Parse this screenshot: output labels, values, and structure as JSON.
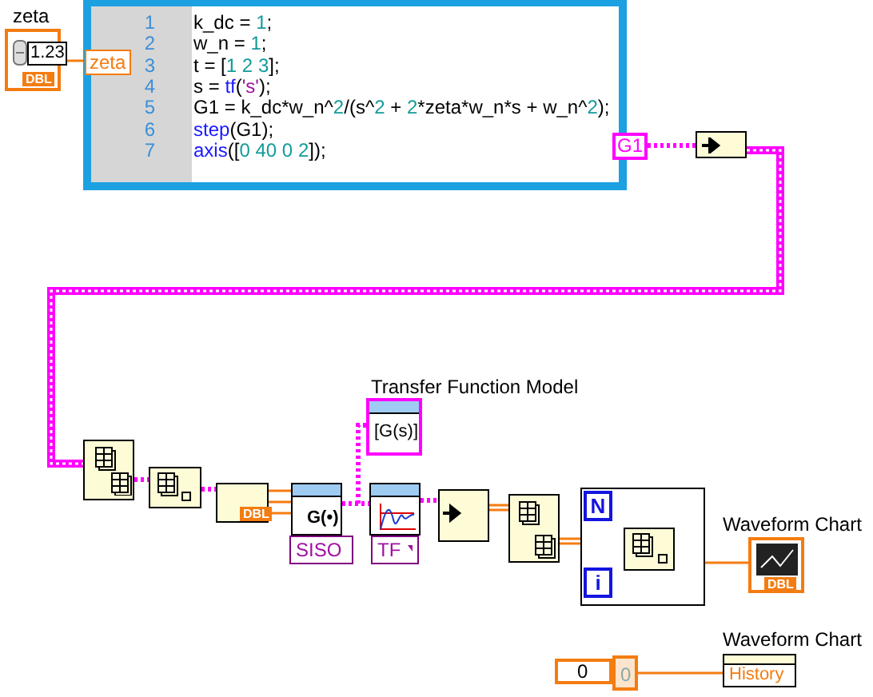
{
  "zeta_control": {
    "label": "zeta",
    "value": "1.23",
    "type": "DBL"
  },
  "zeta_input": "zeta",
  "script_node": {
    "lines": [
      {
        "number": "1",
        "code": "k_dc = 1;"
      },
      {
        "number": "2",
        "code": "w_n = 1;"
      },
      {
        "number": "3",
        "code": "t = [1 2 3];"
      },
      {
        "number": "4",
        "code": "s = tf('s');"
      },
      {
        "number": "5",
        "code": "G1 = k_dc*w_n^2/(s^2 + 2*zeta*w_n*s + w_n^2);"
      },
      {
        "number": "6",
        "code": "step(G1);"
      },
      {
        "number": "7",
        "code": "axis([0 40 0 2]);"
      }
    ],
    "output": "G1"
  },
  "unbundle_type": "DBL",
  "model_node": {
    "label": "Transfer Function Model",
    "content": "[G(s)]"
  },
  "construct_node": {
    "content": "G(•)",
    "selector": "SISO"
  },
  "step_node": {
    "selector": "TF"
  },
  "loop": {
    "count": "N",
    "iteration": "i"
  },
  "chart": {
    "label": "Waveform Chart",
    "type": "DBL"
  },
  "property_node": {
    "label": "Waveform Chart",
    "property": "History"
  },
  "numeric_control": {
    "value": "0"
  },
  "constant": {
    "value": "0"
  }
}
